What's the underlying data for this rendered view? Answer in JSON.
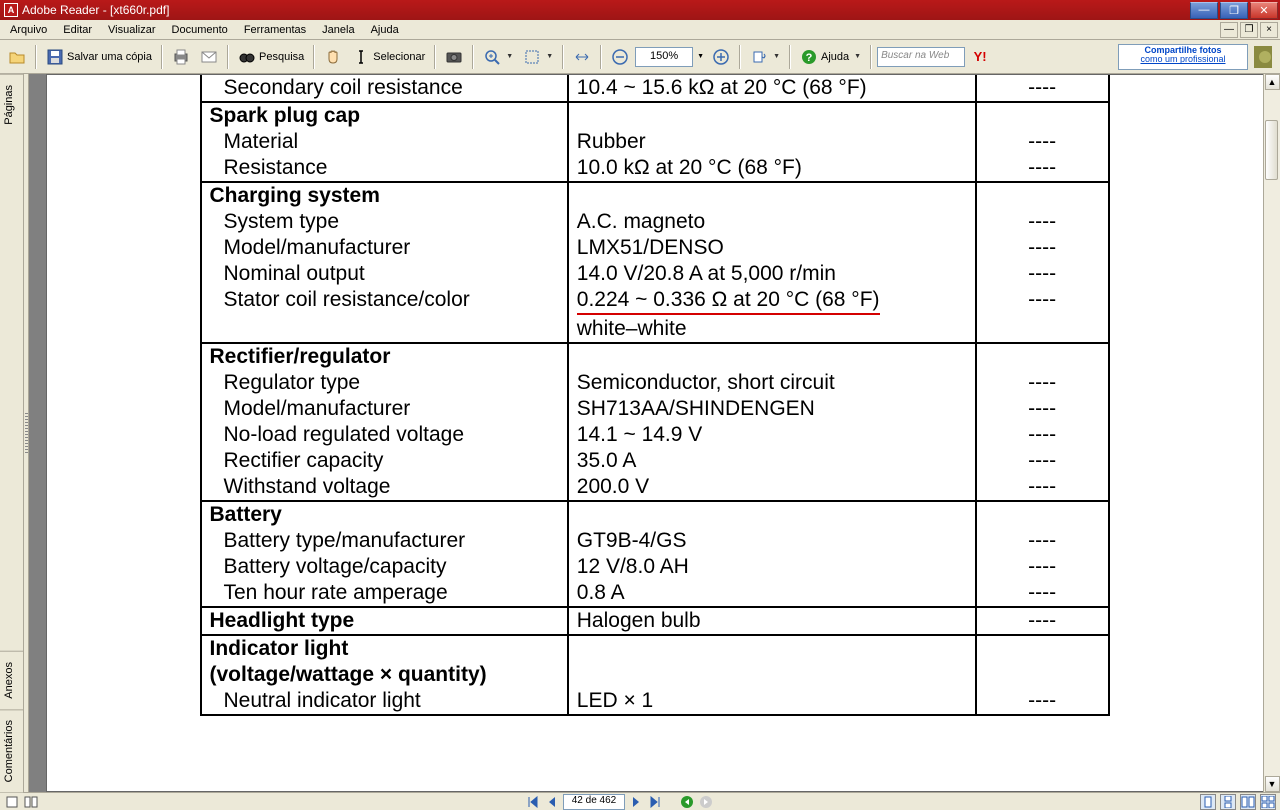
{
  "titlebar": {
    "text": "Adobe Reader - [xt660r.pdf]"
  },
  "menu": {
    "arquivo": "Arquivo",
    "editar": "Editar",
    "visualizar": "Visualizar",
    "documento": "Documento",
    "ferramentas": "Ferramentas",
    "janela": "Janela",
    "ajuda": "Ajuda"
  },
  "toolbar": {
    "save_copy": "Salvar uma cópia",
    "search": "Pesquisa",
    "select": "Selecionar",
    "zoom_value": "150%",
    "help": "Ajuda",
    "search_placeholder": "Buscar na Web",
    "ad_line1": "Compartilhe fotos",
    "ad_line2": "como um profissional"
  },
  "sidebar": {
    "pages": "Páginas",
    "attachments": "Anexos",
    "comments": "Comentários"
  },
  "status": {
    "page_text": "42 de 462"
  },
  "table": {
    "rows": [
      {
        "type": "sub_top",
        "c1": "Secondary coil resistance",
        "c2": "10.4 ~ 15.6 kΩ at 20 °C (68 °F)",
        "c3": "----"
      },
      {
        "type": "section",
        "header": "Spark plug cap",
        "subs": [
          {
            "c1": "Material",
            "c2": "Rubber",
            "c3": "----"
          },
          {
            "c1": "Resistance",
            "c2": "10.0 kΩ at 20 °C (68 °F)",
            "c3": "----"
          }
        ]
      },
      {
        "type": "section",
        "header": "Charging system",
        "subs": [
          {
            "c1": "System type",
            "c2": "A.C. magneto",
            "c3": "----"
          },
          {
            "c1": "Model/manufacturer",
            "c2": "LMX51/DENSO",
            "c3": "----"
          },
          {
            "c1": "Nominal output",
            "c2": "14.0 V/20.8 A at 5,000 r/min",
            "c3": "----"
          },
          {
            "c1": "Stator coil resistance/color",
            "c2": "0.224 ~ 0.336 Ω at 20 °C (68 °F)",
            "c2b": "white–white",
            "c3": "----",
            "underline": true
          }
        ]
      },
      {
        "type": "section",
        "header": "Rectifier/regulator",
        "subs": [
          {
            "c1": "Regulator type",
            "c2": "Semiconductor, short circuit",
            "c3": "----"
          },
          {
            "c1": "Model/manufacturer",
            "c2": "SH713AA/SHINDENGEN",
            "c3": "----"
          },
          {
            "c1": "No-load regulated voltage",
            "c2": "14.1 ~ 14.9 V",
            "c3": "----"
          },
          {
            "c1": "Rectifier capacity",
            "c2": "35.0 A",
            "c3": "----"
          },
          {
            "c1": "Withstand voltage",
            "c2": "200.0 V",
            "c3": "----"
          }
        ]
      },
      {
        "type": "section",
        "header": "Battery",
        "subs": [
          {
            "c1": "Battery type/manufacturer",
            "c2": "GT9B-4/GS",
            "c3": "----"
          },
          {
            "c1": "Battery voltage/capacity",
            "c2": "12 V/8.0 AH",
            "c3": "----"
          },
          {
            "c1": "Ten hour rate amperage",
            "c2": "0.8 A",
            "c3": "----"
          }
        ]
      },
      {
        "type": "section_single",
        "header": "Headlight type",
        "c2": "Halogen bulb",
        "c3": "----"
      },
      {
        "type": "section",
        "header": "Indicator light",
        "header2": "(voltage/wattage × quantity)",
        "subs": [
          {
            "c1": "Neutral indicator light",
            "c2": "LED × 1",
            "c3": "----"
          }
        ]
      }
    ]
  }
}
